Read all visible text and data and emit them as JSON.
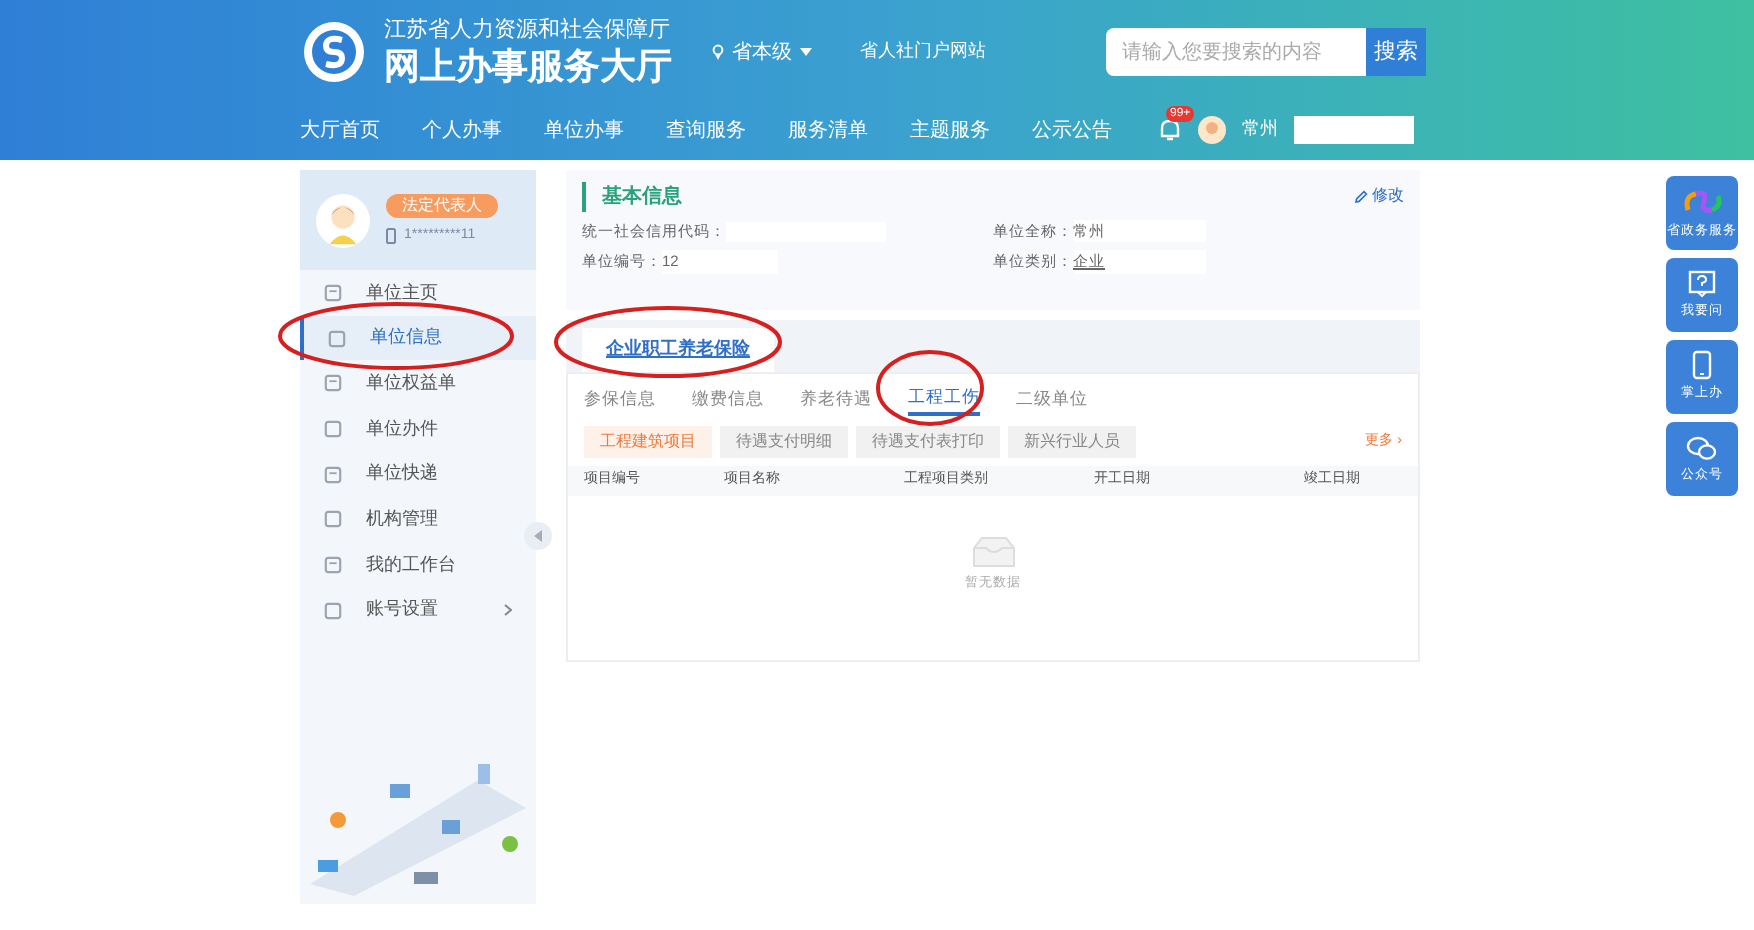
{
  "header": {
    "org": "江苏省人力资源和社会保障厅",
    "title": "网上办事服务大厅",
    "region": "省本级",
    "portal_link": "省人社门户网站",
    "search": {
      "placeholder": "请输入您要搜索的内容",
      "button": "搜索"
    }
  },
  "nav": {
    "items": [
      "大厅首页",
      "个人办事",
      "单位办事",
      "查询服务",
      "服务清单",
      "主题服务",
      "公示公告"
    ],
    "badge": "99+",
    "user": "常州"
  },
  "sidebar": {
    "role": "法定代表人",
    "phone": "1*********11",
    "items": [
      {
        "label": "单位主页",
        "selected": false,
        "has_arrow": false
      },
      {
        "label": "单位信息",
        "selected": true,
        "has_arrow": false
      },
      {
        "label": "单位权益单",
        "selected": false,
        "has_arrow": false
      },
      {
        "label": "单位办件",
        "selected": false,
        "has_arrow": false
      },
      {
        "label": "单位快递",
        "selected": false,
        "has_arrow": false
      },
      {
        "label": "机构管理",
        "selected": false,
        "has_arrow": false
      },
      {
        "label": "我的工作台",
        "selected": false,
        "has_arrow": false
      },
      {
        "label": "账号设置",
        "selected": false,
        "has_arrow": true
      }
    ]
  },
  "basic_info": {
    "title": "基本信息",
    "edit": "修改",
    "fields": [
      {
        "label": "统一社会信用代码："
      },
      {
        "label": "单位全称：",
        "value": "常州"
      },
      {
        "label": "单位编号：",
        "value": "12"
      },
      {
        "label": "单位类别：",
        "value": "企业"
      }
    ]
  },
  "insurance_tab": {
    "label": "企业职工养老保险",
    "selected": true
  },
  "sub_tabs": [
    {
      "label": "参保信息",
      "selected": false
    },
    {
      "label": "缴费信息",
      "selected": false
    },
    {
      "label": "养老待遇",
      "selected": false
    },
    {
      "label": "工程工伤",
      "selected": true
    },
    {
      "label": "二级单位",
      "selected": false
    }
  ],
  "filters": [
    {
      "label": "工程建筑项目",
      "selected": true
    },
    {
      "label": "待遇支付明细",
      "selected": false
    },
    {
      "label": "待遇支付表打印",
      "selected": false
    },
    {
      "label": "新兴行业人员",
      "selected": false
    }
  ],
  "more": "更多 ›",
  "table": {
    "columns": [
      "项目编号",
      "项目名称",
      "工程项目类别",
      "开工日期",
      "竣工日期"
    ],
    "empty": "暂无数据"
  },
  "side_buttons": [
    {
      "kind": "logo",
      "label": "省政务服务"
    },
    {
      "kind": "question",
      "label": "我要问"
    },
    {
      "kind": "phone",
      "label": "掌上办"
    },
    {
      "kind": "wechat",
      "label": "公众号"
    }
  ]
}
